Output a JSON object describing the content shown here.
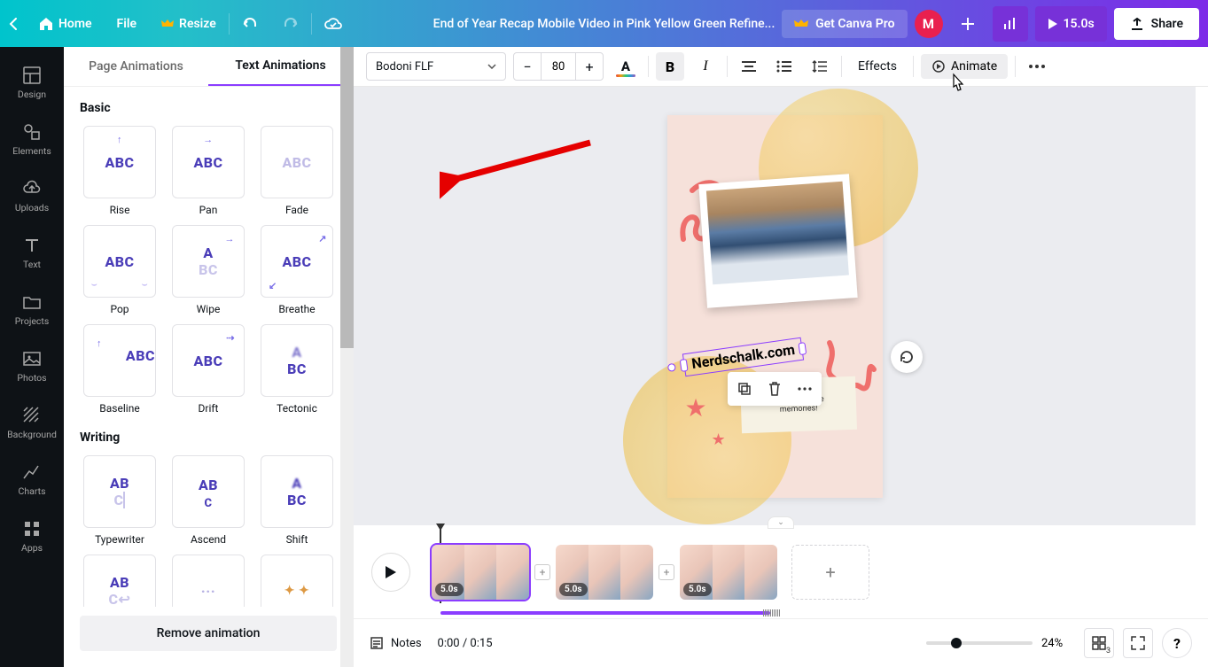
{
  "header": {
    "home": "Home",
    "file": "File",
    "resize": "Resize",
    "title": "End of Year Recap Mobile Video in Pink Yellow Green Refine...",
    "get_pro": "Get Canva Pro",
    "avatar_initial": "M",
    "play_time": "15.0s",
    "share": "Share"
  },
  "rail": {
    "design": "Design",
    "elements": "Elements",
    "uploads": "Uploads",
    "text": "Text",
    "projects": "Projects",
    "photos": "Photos",
    "background": "Background",
    "charts": "Charts",
    "apps": "Apps"
  },
  "panel": {
    "tab_page": "Page Animations",
    "tab_text": "Text Animations",
    "sec_basic": "Basic",
    "sec_writing": "Writing",
    "basic": [
      "Rise",
      "Pan",
      "Fade",
      "Pop",
      "Wipe",
      "Breathe",
      "Baseline",
      "Drift",
      "Tectonic"
    ],
    "writing": [
      "Typewriter",
      "Ascend",
      "Shift"
    ],
    "remove": "Remove animation"
  },
  "ctx": {
    "font": "Bodoni FLF",
    "size": "80",
    "effects": "Effects",
    "animate": "Animate"
  },
  "canvas": {
    "text_content": "Nerdschalk.com",
    "note_line1": "Thanks for the",
    "note_line2": "memories!"
  },
  "timeline": {
    "clip1": "5.0s",
    "clip2": "5.0s",
    "clip3": "5.0s"
  },
  "footer": {
    "notes": "Notes",
    "time": "0:00 / 0:15",
    "zoom": "24%",
    "pages_badge": "3"
  }
}
